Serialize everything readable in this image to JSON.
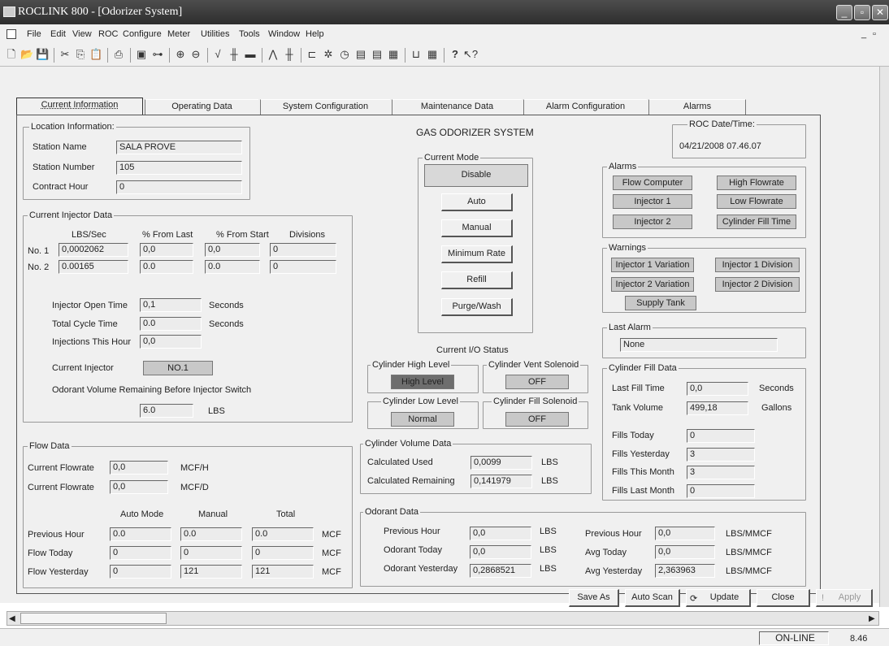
{
  "window": {
    "title": "ROCLINK 800 - [Odorizer System]"
  },
  "menu": [
    "File",
    "Edit",
    "View",
    "ROC",
    "Configure",
    "Meter",
    "Utilities",
    "Tools",
    "Window",
    "Help"
  ],
  "toolbar": {
    "help_label": "?"
  },
  "tabs": [
    "Current Information",
    "Operating Data",
    "System Configuration",
    "Maintenance Data",
    "Alarm Configuration",
    "Alarms"
  ],
  "system_title": "GAS ODORIZER SYSTEM",
  "location": {
    "title": "Location Information:",
    "station_name_label": "Station Name",
    "station_name": "SALA PROVE",
    "station_number_label": "Station Number",
    "station_number": "105",
    "contract_hour_label": "Contract Hour",
    "contract_hour": "0"
  },
  "injector": {
    "title": "Current Injector Data",
    "headers": [
      "LBS/Sec",
      "% From Last",
      "% From Start",
      "Divisions"
    ],
    "rows": [
      {
        "label": "No. 1",
        "values": [
          "0,0002062",
          "0,0",
          "0,0",
          "0"
        ]
      },
      {
        "label": "No. 2",
        "values": [
          "0.00165",
          "0.0",
          "0.0",
          "0"
        ]
      }
    ],
    "open_time_label": "Injector Open Time",
    "open_time": "0,1",
    "open_time_unit": "Seconds",
    "cycle_label": "Total Cycle Time",
    "cycle": "0.0",
    "cycle_unit": "Seconds",
    "injections_label": "Injections This Hour",
    "injections": "0,0",
    "current_label": "Current Injector",
    "current": "NO.1",
    "remaining_label": "Odorant Volume Remaining Before Injector Switch",
    "remaining": "6.0",
    "remaining_unit": "LBS"
  },
  "flow": {
    "title": "Flow Data",
    "rate1_label": "Current Flowrate",
    "rate1": "0,0",
    "rate1_unit": "MCF/H",
    "rate2_label": "Current Flowrate",
    "rate2": "0,0",
    "rate2_unit": "MCF/D",
    "headers": [
      "Auto Mode",
      "Manual",
      "Total"
    ],
    "rows": [
      {
        "label": "Previous Hour",
        "values": [
          "0.0",
          "0.0",
          "0.0"
        ],
        "unit": "MCF"
      },
      {
        "label": "Flow Today",
        "values": [
          "0",
          "0",
          "0"
        ],
        "unit": "MCF"
      },
      {
        "label": "Flow Yesterday",
        "values": [
          "0",
          "121",
          "121"
        ],
        "unit": "MCF"
      }
    ]
  },
  "mode": {
    "title": "Current Mode",
    "buttons": [
      "Disable",
      "Auto",
      "Manual",
      "Minimum Rate",
      "Refill",
      "Purge/Wash"
    ]
  },
  "io": {
    "title": "Current I/O Status",
    "high_level_label": "Cylinder High Level",
    "high_level": "High Level",
    "vent_label": "Cylinder Vent Solenoid",
    "vent": "OFF",
    "low_level_label": "Cylinder Low Level",
    "low_level": "Normal",
    "fill_label": "Cylinder Fill Solenoid",
    "fill": "OFF"
  },
  "cylinder_volume": {
    "title": "Cylinder Volume Data",
    "used_label": "Calculated Used",
    "used": "0,0099",
    "used_unit": "LBS",
    "remaining_label": "Calculated Remaining",
    "remaining": "0,141979",
    "remaining_unit": "LBS"
  },
  "odorant": {
    "title": "Odorant Data",
    "rows": [
      {
        "label": "Previous Hour",
        "value": "0,0",
        "unit": "LBS",
        "label2": "Previous Hour",
        "value2": "0,0",
        "unit2": "LBS/MMCF"
      },
      {
        "label": "Odorant Today",
        "value": "0,0",
        "unit": "LBS",
        "label2": "Avg Today",
        "value2": "0,0",
        "unit2": "LBS/MMCF"
      },
      {
        "label": "Odorant Yesterday",
        "value": "0,2868521",
        "unit": "LBS",
        "label2": "Avg Yesterday",
        "value2": "2,363963",
        "unit2": "LBS/MMCF"
      }
    ]
  },
  "roc_date": {
    "title": "ROC Date/Time:",
    "value": "04/21/2008 07.46.07"
  },
  "alarms": {
    "title": "Alarms",
    "items": [
      "Flow Computer",
      "High Flowrate",
      "Injector 1",
      "Low Flowrate",
      "Injector 2",
      "Cylinder Fill Time"
    ]
  },
  "warnings": {
    "title": "Warnings",
    "items": [
      "Injector 1 Variation",
      "Injector 1 Division",
      "Injector 2 Variation",
      "Injector 2 Division",
      "Supply Tank"
    ]
  },
  "last_alarm": {
    "title": "Last Alarm",
    "value": "None"
  },
  "fill": {
    "title": "Cylinder Fill Data",
    "last_fill_label": "Last Fill Time",
    "last_fill": "0,0",
    "last_fill_unit": "Seconds",
    "tank_label": "Tank Volume",
    "tank": "499,18",
    "tank_unit": "Gallons",
    "rows": [
      {
        "label": "Fills Today",
        "value": "0"
      },
      {
        "label": "Fills Yesterday",
        "value": "3"
      },
      {
        "label": "Fills This Month",
        "value": "3"
      },
      {
        "label": "Fills Last Month",
        "value": "0"
      }
    ]
  },
  "actions": [
    "Save As",
    "Auto Scan",
    "Update",
    "Close",
    "Apply"
  ],
  "status": {
    "state": "ON-LINE",
    "version": "8.46"
  }
}
